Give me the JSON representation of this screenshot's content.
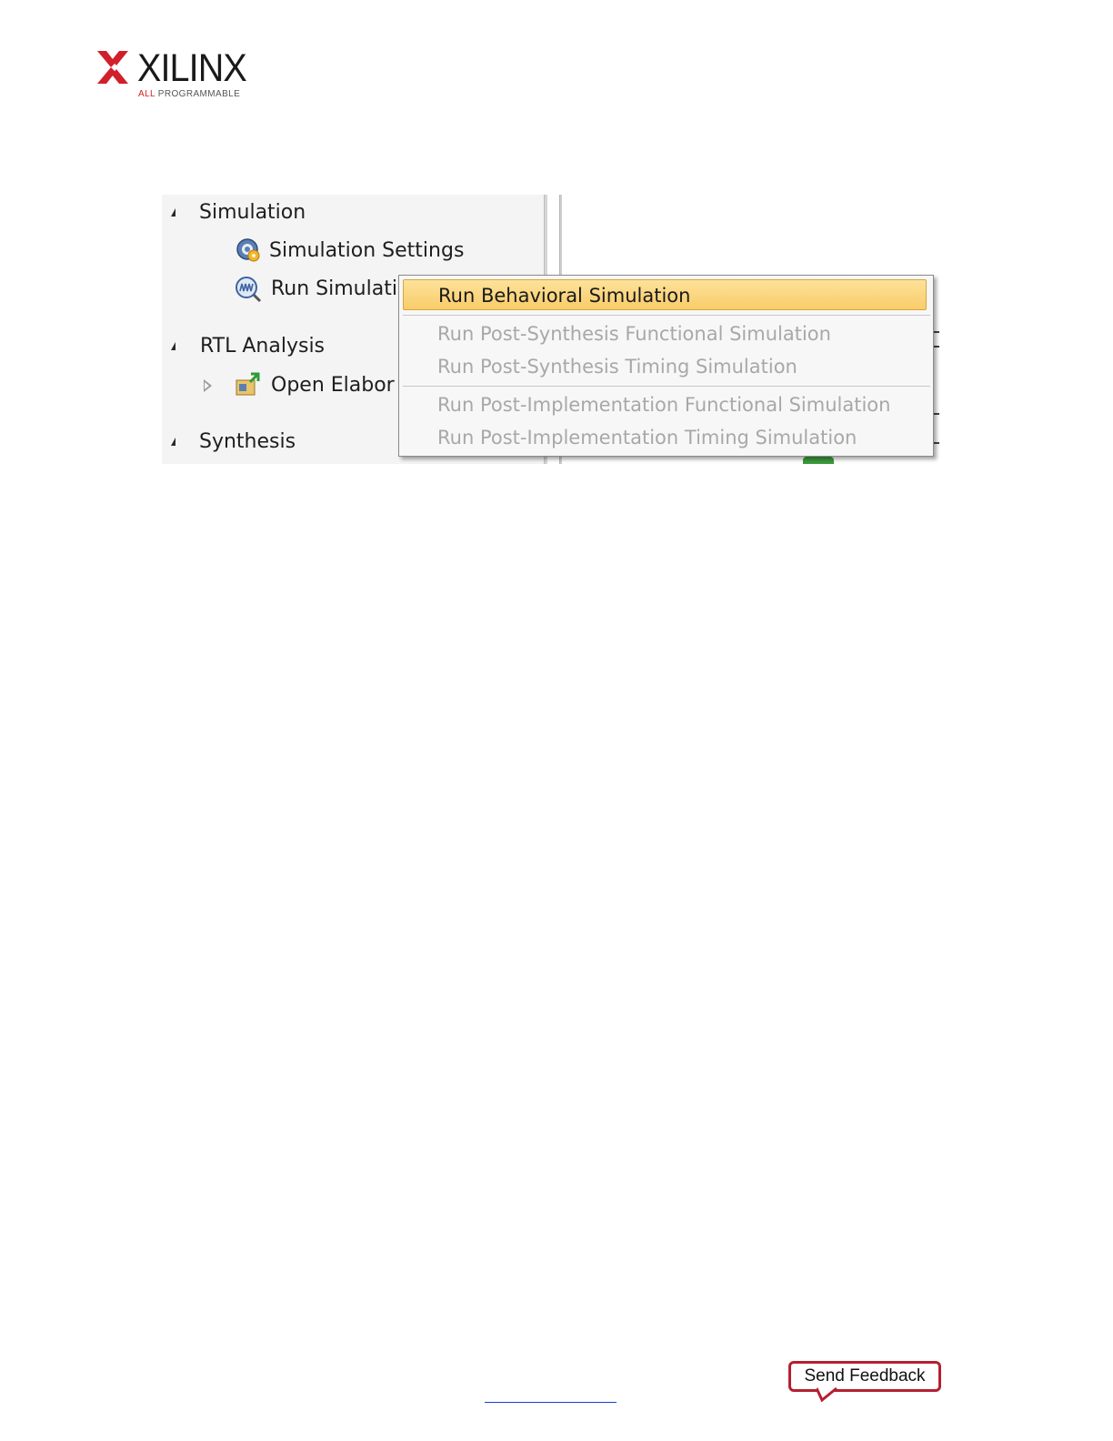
{
  "logo": {
    "word": "XILINX",
    "tagline_red": "ALL",
    "tagline_rest": " PROGRAMMABLE",
    "brand_color": "#d0202b"
  },
  "flow_navigator": {
    "sections": [
      {
        "label": "Simulation",
        "items": [
          {
            "label": "Simulation Settings",
            "icon": "gear-icon"
          },
          {
            "label": "Run Simulatio",
            "icon": "waveform-magnifier-icon"
          }
        ]
      },
      {
        "label": "RTL Analysis",
        "items": [
          {
            "label": "Open Elabor",
            "icon": "open-design-icon"
          }
        ]
      },
      {
        "label": "Synthesis",
        "items": []
      }
    ]
  },
  "context_menu": {
    "items": [
      {
        "label": "Run Behavioral Simulation",
        "enabled": true,
        "highlighted": true
      },
      {
        "label": "Run Post-Synthesis Functional Simulation",
        "enabled": false
      },
      {
        "label": "Run Post-Synthesis Timing Simulation",
        "enabled": false
      },
      {
        "label": "Run Post-Implementation Functional Simulation",
        "enabled": false
      },
      {
        "label": "Run Post-Implementation Timing Simulation",
        "enabled": false
      }
    ],
    "highlight_color": "#f9cc6a",
    "disabled_text_color": "#a8a8a8"
  },
  "footer": {
    "feedback_label": "Send Feedback",
    "feedback_color": "#b5202f"
  }
}
